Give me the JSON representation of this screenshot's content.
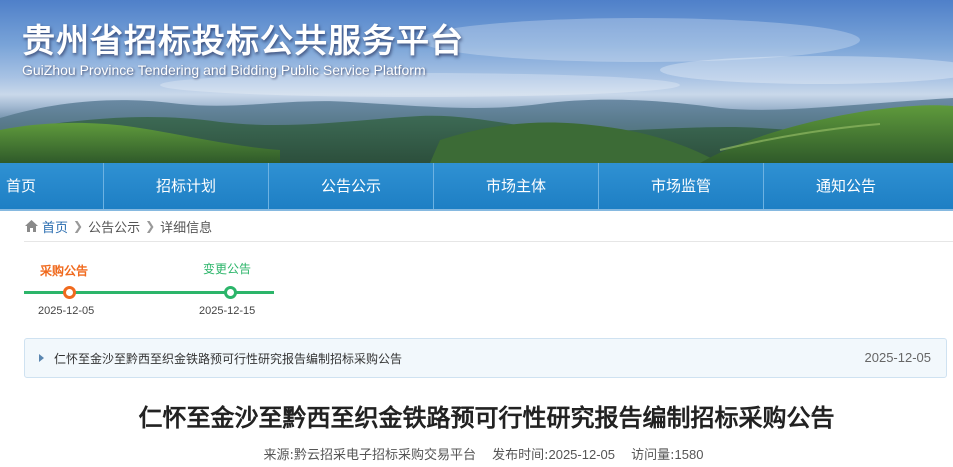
{
  "header": {
    "title": "贵州省招标投标公共服务平台",
    "subtitle": "GuiZhou Province Tendering and Bidding Public Service Platform"
  },
  "nav": {
    "items": [
      {
        "label": "首页"
      },
      {
        "label": "招标计划"
      },
      {
        "label": "公告公示"
      },
      {
        "label": "市场主体"
      },
      {
        "label": "市场监管"
      },
      {
        "label": "通知公告"
      }
    ]
  },
  "breadcrumb": {
    "home": "首页",
    "section": "公告公示",
    "current": "详细信息",
    "icon": "home-icon"
  },
  "timeline": {
    "steps": [
      {
        "label": "采购公告",
        "date": "2025-12-05",
        "status": "current",
        "color": "#f06a1e"
      },
      {
        "label": "变更公告",
        "date": "2025-12-15",
        "status": "done",
        "color": "#2cb56a"
      }
    ]
  },
  "notice_list": {
    "items": [
      {
        "title": "仁怀至金沙至黔西至织金铁路预可行性研究报告编制招标采购公告",
        "date": "2025-12-05"
      }
    ]
  },
  "article": {
    "title": "仁怀至金沙至黔西至织金铁路预可行性研究报告编制招标采购公告",
    "source_label": "来源:",
    "source": "黔云招采电子招标采购交易平台",
    "publish_label": "发布时间:",
    "publish_time": "2025-12-05",
    "views_label": "访问量:",
    "views": "1580"
  },
  "colors": {
    "nav_bg": "#1e7fc4",
    "timeline_green": "#2cb56a",
    "timeline_orange": "#f06a1e"
  }
}
